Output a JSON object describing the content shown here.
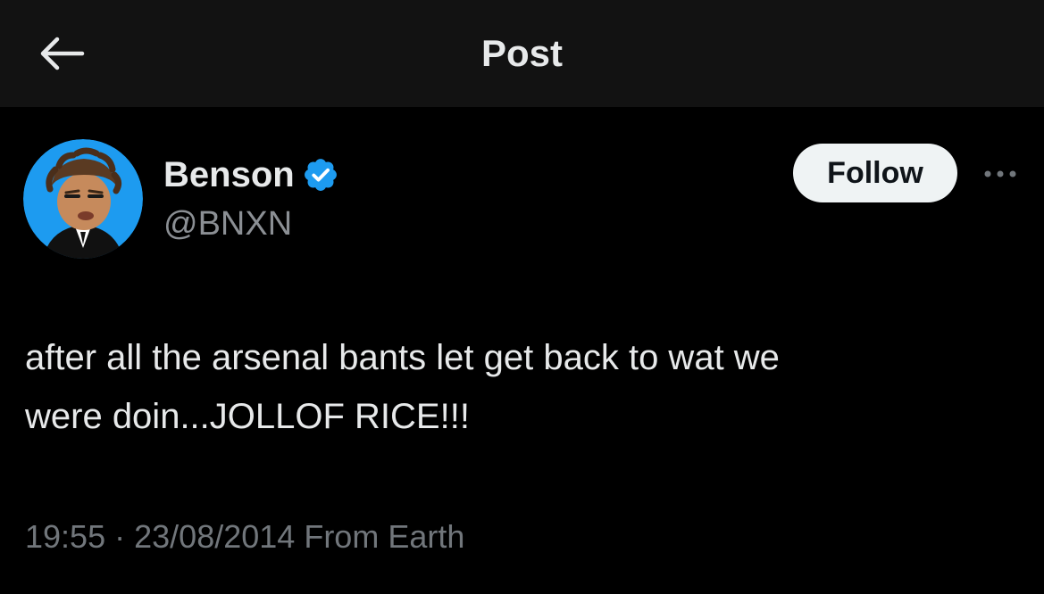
{
  "header": {
    "title": "Post",
    "back_icon": "arrow-left-icon"
  },
  "post": {
    "author": {
      "display_name": "Benson",
      "handle": "@BNXN",
      "verified": true,
      "verified_icon": "verified-badge-icon",
      "avatar_background": "#1d9bf0"
    },
    "follow_label": "Follow",
    "more_icon": "more-options-icon",
    "text": "after all the arsenal bants let get back to wat we\nwere doin...JOLLOF RICE!!!",
    "time": "19:55",
    "separator": "·",
    "date": "23/08/2014",
    "location": "From Earth"
  },
  "colors": {
    "background": "#000000",
    "header_background": "#121212",
    "primary_text": "#e7e9ea",
    "secondary_text": "#71767b",
    "verified": "#1d9bf0",
    "follow_button": "#eff3f4"
  }
}
